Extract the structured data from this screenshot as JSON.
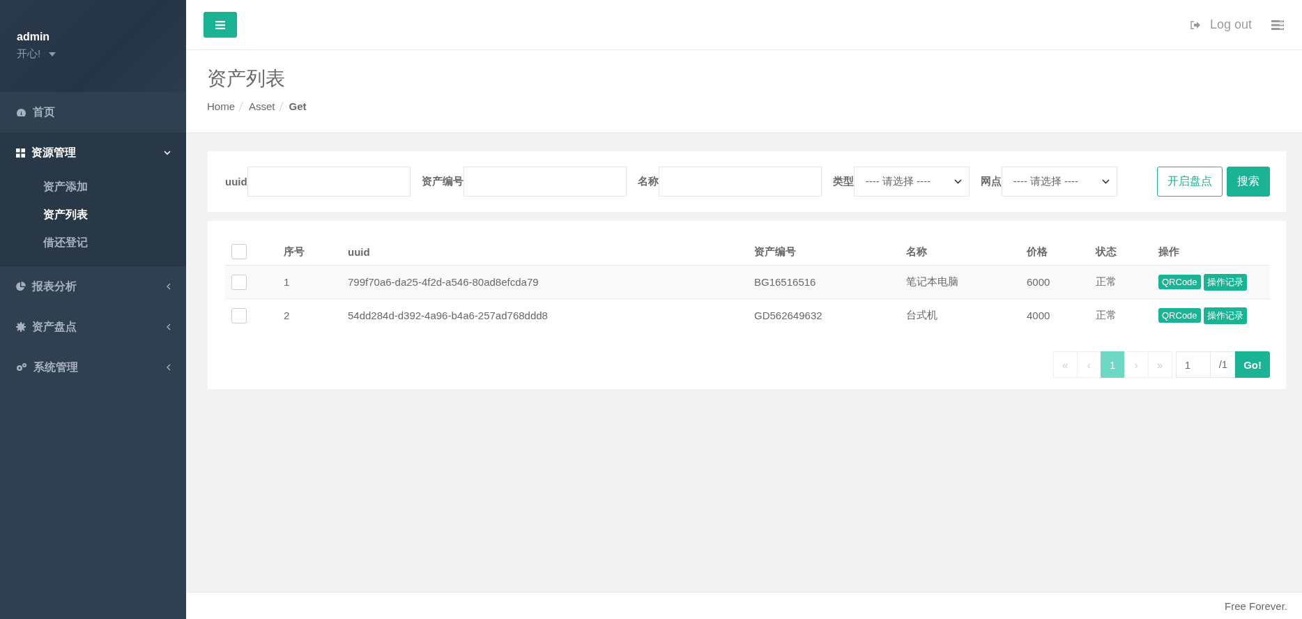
{
  "sidebar": {
    "user": {
      "name": "admin",
      "motto": "开心!"
    },
    "items": [
      {
        "kind": "link",
        "label": "首页",
        "expanded": false
      },
      {
        "kind": "group",
        "label": "资源管理",
        "expanded": true,
        "children": [
          {
            "label": "资产添加",
            "selected": false
          },
          {
            "label": "资产列表",
            "selected": true
          },
          {
            "label": "借还登记",
            "selected": false
          }
        ]
      },
      {
        "kind": "group",
        "label": "报表分析",
        "expanded": false
      },
      {
        "kind": "group",
        "label": "资产盘点",
        "expanded": false
      },
      {
        "kind": "group",
        "label": "系统管理",
        "expanded": false
      }
    ]
  },
  "topbar": {
    "logout": "Log out"
  },
  "page": {
    "title": "资产列表",
    "breadcrumb": [
      {
        "label": "Home",
        "active": false
      },
      {
        "label": "Asset",
        "active": false
      },
      {
        "label": "Get",
        "active": true
      }
    ]
  },
  "search": {
    "fields": [
      {
        "kind": "input",
        "label": "uuid"
      },
      {
        "kind": "input",
        "label": "资产编号"
      },
      {
        "kind": "input",
        "label": "名称"
      },
      {
        "kind": "select",
        "label": "类型",
        "value": "---- 请选择 ----"
      },
      {
        "kind": "select",
        "label": "网点",
        "value": "---- 请选择 ----"
      }
    ],
    "buttons": [
      {
        "kind": "outline",
        "label": "开启盘点"
      },
      {
        "kind": "primary",
        "label": "搜索"
      }
    ]
  },
  "table": {
    "header_checked": false,
    "columns": [
      "序号",
      "uuid",
      "资产编号",
      "名称",
      "价格",
      "状态",
      "操作"
    ],
    "rows": [
      {
        "checked": false,
        "cells": [
          "1",
          "799f70a6-da25-4f2d-a546-80ad8efcda79",
          "BG16516516",
          "笔记本电脑",
          "6000",
          "正常"
        ],
        "actions": [
          "QRCode",
          "操作记录"
        ]
      },
      {
        "checked": false,
        "cells": [
          "2",
          "54dd284d-d392-4a96-b4a6-257ad768ddd8",
          "GD562649632",
          "台式机",
          "4000",
          "正常"
        ],
        "actions": [
          "QRCode",
          "操作记录"
        ]
      }
    ]
  },
  "pager": {
    "items": [
      {
        "label": "«",
        "selected": false,
        "disabled": true
      },
      {
        "label": "‹",
        "selected": false,
        "disabled": true
      },
      {
        "label": "1",
        "selected": true,
        "disabled": false
      },
      {
        "label": "›",
        "selected": false,
        "disabled": true
      },
      {
        "label": "»",
        "selected": false,
        "disabled": true
      }
    ],
    "page_input": "1",
    "total": "/1",
    "go": "Go!"
  },
  "footer": "Free Forever."
}
